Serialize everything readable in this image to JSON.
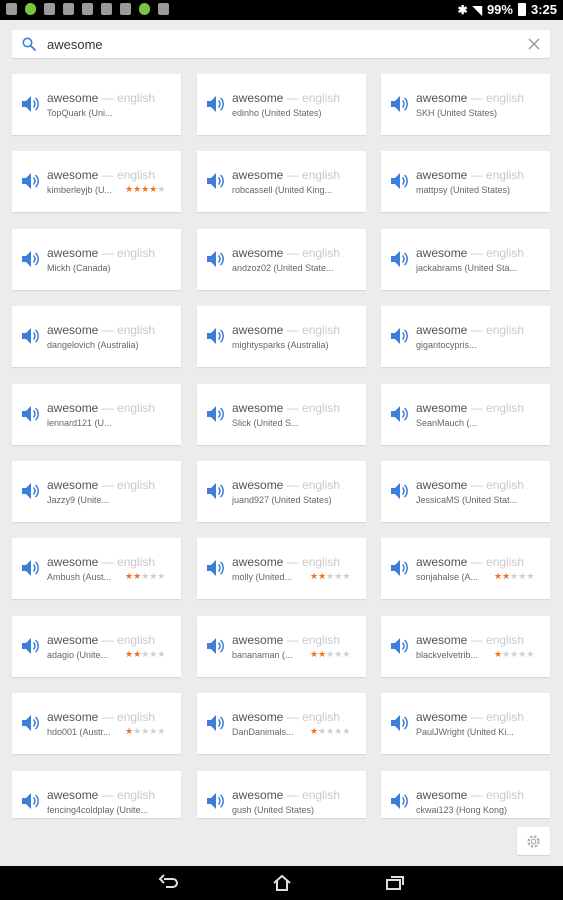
{
  "status_bar": {
    "battery": "99%",
    "time": "3:25"
  },
  "search": {
    "query": "awesome"
  },
  "cards": [
    {
      "word": "awesome",
      "lang": "— english",
      "user": "TopQuark (Uni...",
      "rating": null
    },
    {
      "word": "awesome",
      "lang": "— english",
      "user": "edinho (United States)",
      "rating": null
    },
    {
      "word": "awesome",
      "lang": "— english",
      "user": "SKH (United States)",
      "rating": null
    },
    {
      "word": "awesome",
      "lang": "— english",
      "user": "kimberleyjb (U...",
      "rating": 4
    },
    {
      "word": "awesome",
      "lang": "— english",
      "user": "robcassell (United King...",
      "rating": null
    },
    {
      "word": "awesome",
      "lang": "— english",
      "user": "mattpsy (United States)",
      "rating": null
    },
    {
      "word": "awesome",
      "lang": "— english",
      "user": "Mickh (Canada)",
      "rating": null
    },
    {
      "word": "awesome",
      "lang": "— english",
      "user": "andzoz02 (United State...",
      "rating": null
    },
    {
      "word": "awesome",
      "lang": "— english",
      "user": "jackabrams (United Sta...",
      "rating": null
    },
    {
      "word": "awesome",
      "lang": "— english",
      "user": "dangelovich (Australia)",
      "rating": null
    },
    {
      "word": "awesome",
      "lang": "— english",
      "user": "mightysparks (Australia)",
      "rating": null
    },
    {
      "word": "awesome",
      "lang": "— english",
      "user": "gigantocypris...",
      "rating": null
    },
    {
      "word": "awesome",
      "lang": "— english",
      "user": "lennard121 (U...",
      "rating": null
    },
    {
      "word": "awesome",
      "lang": "— english",
      "user": "Slick (United S...",
      "rating": null
    },
    {
      "word": "awesome",
      "lang": "— english",
      "user": "SeanMauch (...",
      "rating": null
    },
    {
      "word": "awesome",
      "lang": "— english",
      "user": "Jazzy9 (Unite...",
      "rating": null
    },
    {
      "word": "awesome",
      "lang": "— english",
      "user": "juand927 (United States)",
      "rating": null
    },
    {
      "word": "awesome",
      "lang": "— english",
      "user": "JessicaMS (United Stat...",
      "rating": null
    },
    {
      "word": "awesome",
      "lang": "— english",
      "user": "Ambush (Aust...",
      "rating": 2
    },
    {
      "word": "awesome",
      "lang": "— english",
      "user": "molly (United...",
      "rating": 2
    },
    {
      "word": "awesome",
      "lang": "— english",
      "user": "sonjahalse (A...",
      "rating": 2
    },
    {
      "word": "awesome",
      "lang": "— english",
      "user": "adagio (Unite...",
      "rating": 2
    },
    {
      "word": "awesome",
      "lang": "— english",
      "user": "bananaman (...",
      "rating": 2
    },
    {
      "word": "awesome",
      "lang": "— english",
      "user": "blackvelvetrib...",
      "rating": 1
    },
    {
      "word": "awesome",
      "lang": "— english",
      "user": "hdo001 (Austr...",
      "rating": 1
    },
    {
      "word": "awesome",
      "lang": "— english",
      "user": "DanDanimals...",
      "rating": 1
    },
    {
      "word": "awesome",
      "lang": "— english",
      "user": "PaulJWright (United Ki...",
      "rating": null
    },
    {
      "word": "awesome",
      "lang": "— english",
      "user": "fencing4coldplay (Unite...",
      "rating": null
    },
    {
      "word": "awesome",
      "lang": "— english",
      "user": "gush (United States)",
      "rating": null
    },
    {
      "word": "awesome",
      "lang": "— english",
      "user": "ckwai123 (Hong Kong)",
      "rating": null
    }
  ],
  "colors": {
    "accent": "#3d7fd8",
    "star_on": "#f2711c",
    "star_off": "#d0d0d0",
    "background": "#ececec"
  }
}
